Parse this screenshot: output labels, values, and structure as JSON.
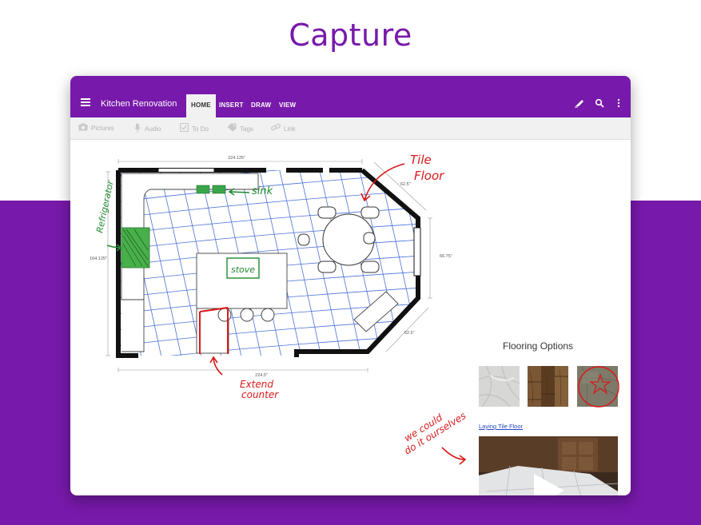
{
  "hero": {
    "title": "Capture"
  },
  "appbar": {
    "title": "Kitchen Renovation",
    "tabs": [
      {
        "label": "HOME",
        "active": true
      },
      {
        "label": "INSERT",
        "active": false
      },
      {
        "label": "DRAW",
        "active": false
      },
      {
        "label": "VIEW",
        "active": false
      }
    ],
    "icons": [
      "pen-icon",
      "search-icon",
      "more-vert-icon"
    ]
  },
  "ribbon": {
    "items": [
      {
        "label": "Pictures",
        "icon": "camera-icon"
      },
      {
        "label": "Audio",
        "icon": "mic-icon"
      },
      {
        "label": "To Do",
        "icon": "checkbox-icon"
      },
      {
        "label": "Tags",
        "icon": "tag-icon"
      },
      {
        "label": "Link",
        "icon": "link-icon"
      }
    ]
  },
  "floorplan": {
    "dims": {
      "top": "224.125\"",
      "left": "164.125\"",
      "right": "66.75\"",
      "bottom": "224.5\"",
      "diag_top": "62.5\"",
      "diag_bottom": "62.5\""
    },
    "annotations": {
      "tile_floor": [
        "Tile",
        "Floor"
      ],
      "sink": "sink",
      "refrigerator": "Refrigerator",
      "stove": "stove",
      "extend_counter": [
        "Extend",
        "counter"
      ],
      "we_could": [
        "we could",
        "do it ourselves"
      ]
    }
  },
  "flooring": {
    "title": "Flooring Options",
    "video_link": "Laying Tile Floor"
  },
  "colors": {
    "brand": "#7719aa",
    "ink_green": "#1f8a2e",
    "ink_red": "#d81a1a",
    "ink_blue": "#3a5bd0"
  }
}
